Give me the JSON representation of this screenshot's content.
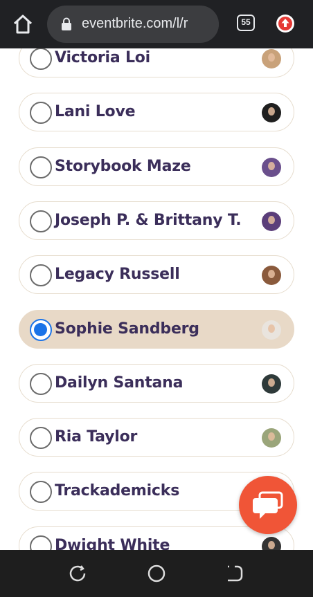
{
  "browser": {
    "url": "eventbrite.com/l/r",
    "tab_count": "55",
    "colors": {
      "bar": "#202124",
      "urlbar": "#3c3d40",
      "update": "#e53935"
    }
  },
  "options": [
    {
      "label": "Victoria Loi",
      "selected": false,
      "avatar": "#c9a27a"
    },
    {
      "label": "Lani Love",
      "selected": false,
      "avatar": "#1f1f1f"
    },
    {
      "label": "Storybook Maze",
      "selected": false,
      "avatar": "#6a4f8c"
    },
    {
      "label": "Joseph P. & Brittany T.",
      "selected": false,
      "avatar": "#5b3e7a"
    },
    {
      "label": "Legacy Russell",
      "selected": false,
      "avatar": "#8a5a3c"
    },
    {
      "label": "Sophie Sandberg",
      "selected": true,
      "avatar": "#e9e4de"
    },
    {
      "label": "Dailyn Santana",
      "selected": false,
      "avatar": "#2e3a3a"
    },
    {
      "label": "Ria Taylor",
      "selected": false,
      "avatar": "#9aa57a"
    },
    {
      "label": "Trackademicks",
      "selected": false,
      "avatar": "#444444"
    },
    {
      "label": "Dwight White",
      "selected": false,
      "avatar": "#333333"
    }
  ],
  "theme": {
    "label_color": "#3b2e5a",
    "border": "#e6dccd",
    "selected_bg": "#e8d9c7",
    "radio_selected": "#1a73e8",
    "chat_button": "#f05537"
  },
  "icons": {
    "home": "home-icon",
    "lock": "lock-icon",
    "tabs": "tab-switcher-icon",
    "update": "update-icon",
    "chat": "chat-icon",
    "nav_recent": "recent-apps-icon",
    "nav_home": "home-circle-icon",
    "nav_back": "back-icon"
  }
}
